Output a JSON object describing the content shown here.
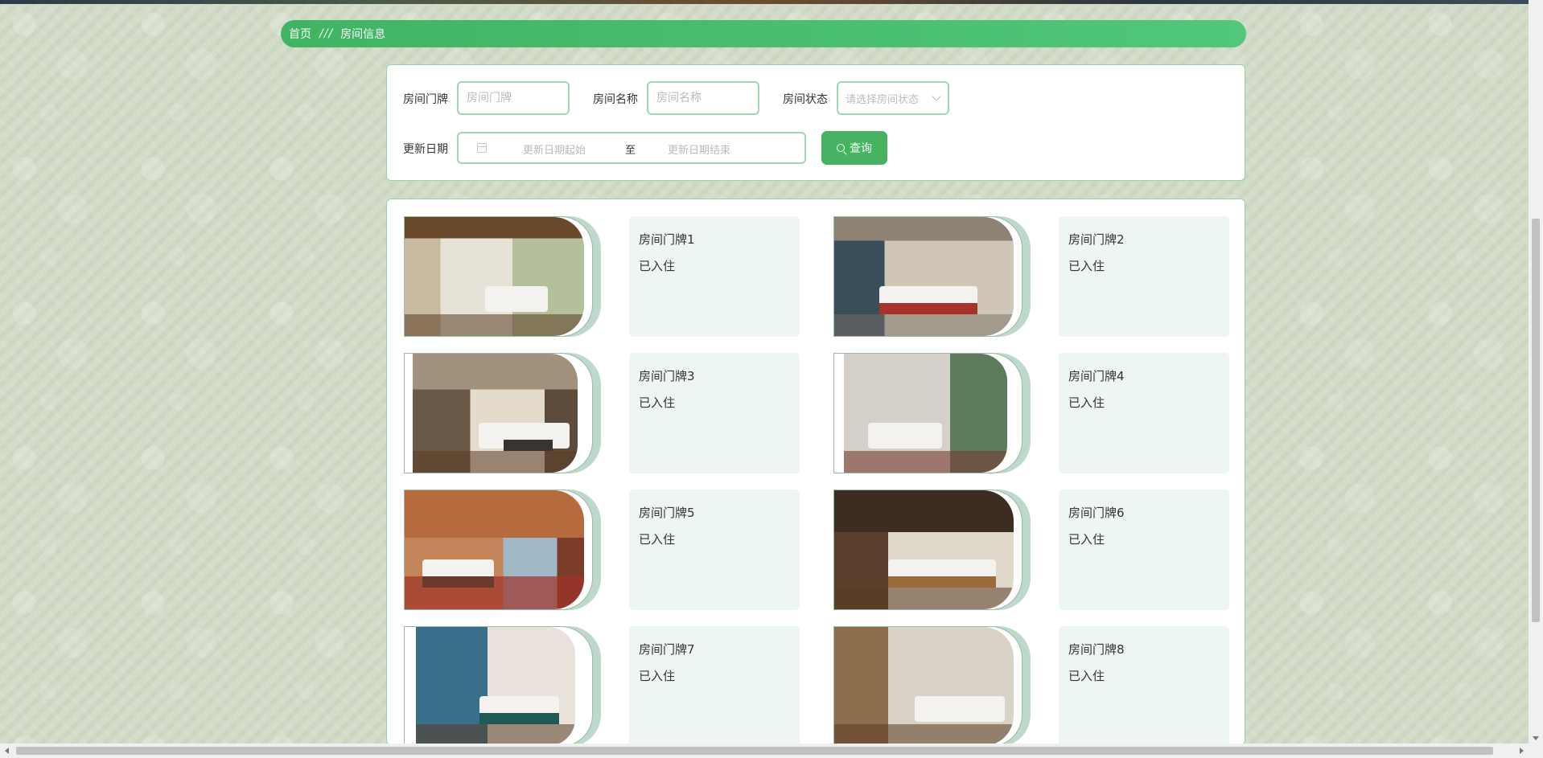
{
  "breadcrumb": {
    "home": "首页",
    "separator": "///",
    "current": "房间信息"
  },
  "search": {
    "room_number_label": "房间门牌",
    "room_number_placeholder": "房间门牌",
    "room_name_label": "房间名称",
    "room_name_placeholder": "房间名称",
    "room_status_label": "房间状态",
    "room_status_placeholder": "请选择房间状态",
    "update_date_label": "更新日期",
    "date_start_placeholder": "更新日期起始",
    "date_to": "至",
    "date_end_placeholder": "更新日期结束",
    "query_button": "查询"
  },
  "rooms": [
    {
      "name": "房间门牌1",
      "status": "已入住"
    },
    {
      "name": "房间门牌2",
      "status": "已入住"
    },
    {
      "name": "房间门牌3",
      "status": "已入住"
    },
    {
      "name": "房间门牌4",
      "status": "已入住"
    },
    {
      "name": "房间门牌5",
      "status": "已入住"
    },
    {
      "name": "房间门牌6",
      "status": "已入住"
    },
    {
      "name": "房间门牌7",
      "status": "已入住"
    },
    {
      "name": "房间门牌8",
      "status": "已入住"
    }
  ],
  "colors": {
    "primary_green": "#45b35f",
    "border_green": "#9ed8b2",
    "card_bg": "#eef6f1"
  }
}
